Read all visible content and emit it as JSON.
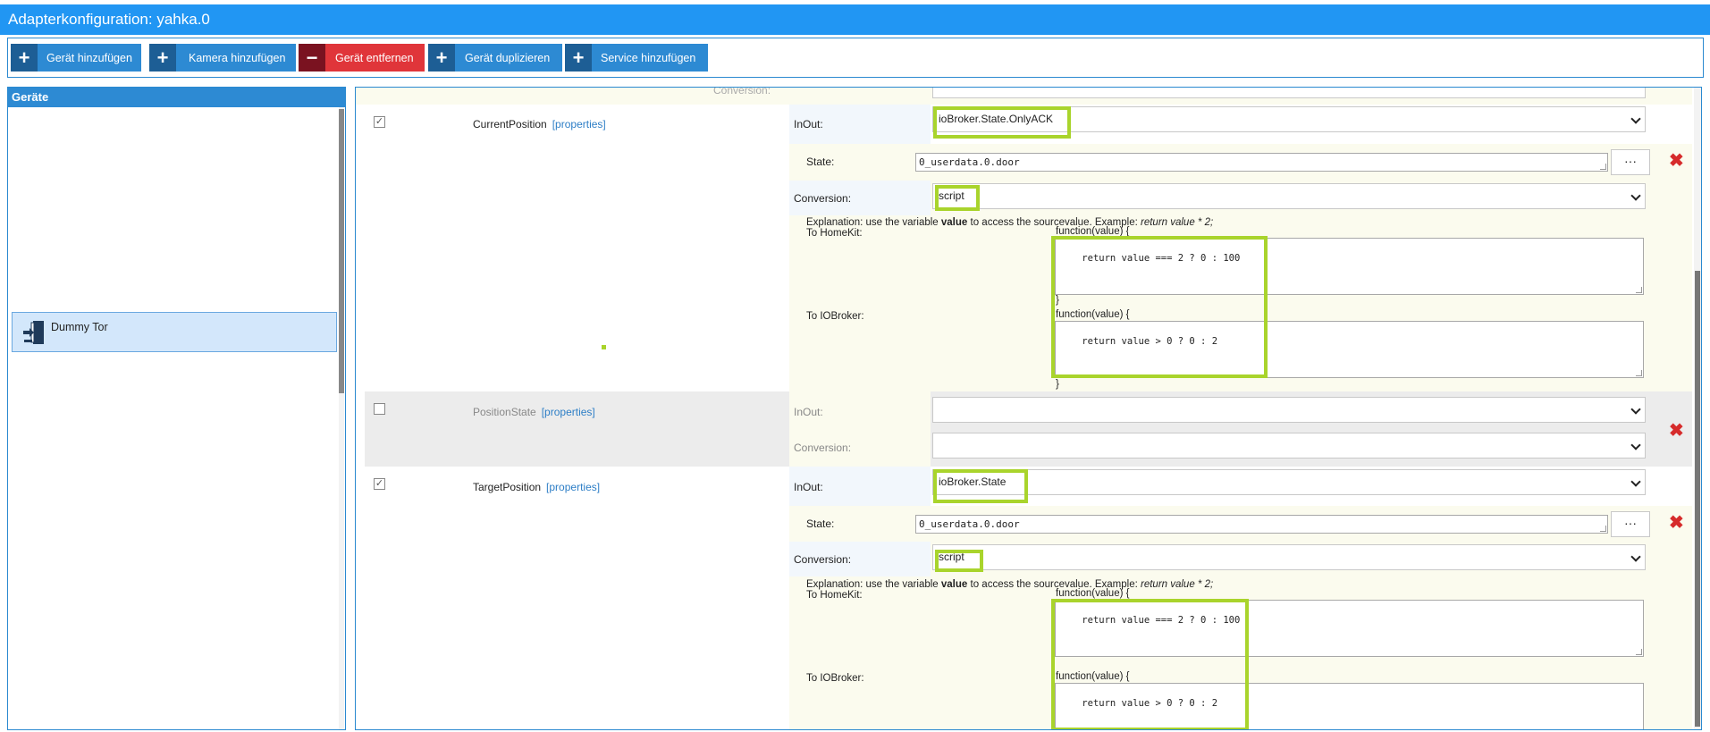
{
  "app": {
    "title": "Adapterkonfiguration: yahka.0"
  },
  "toolbar": {
    "buttons": [
      {
        "icon": "plus-icon",
        "symbol": "+",
        "label": "Gerät hinzufügen"
      },
      {
        "icon": "plus-icon",
        "symbol": "+",
        "label": "Kamera hinzufügen"
      },
      {
        "icon": "minus-icon",
        "symbol": "−",
        "label": "Gerät entfernen"
      },
      {
        "icon": "plus-icon",
        "symbol": "+",
        "label": "Gerät duplizieren"
      },
      {
        "icon": "plus-icon",
        "symbol": "+",
        "label": "Service hinzufügen"
      }
    ]
  },
  "sidebar": {
    "header": "Geräte",
    "items": [
      {
        "icon": "door-exit-icon",
        "label": "Dummy Tor"
      }
    ]
  },
  "main": {
    "clipped_label": "Conversion:",
    "characteristics": [
      {
        "name": "CurrentPosition",
        "properties": "[properties]",
        "checked_glyph": "✓",
        "inout_label": "InOut:",
        "inout_value": "ioBroker.State.OnlyACK",
        "state_label": "State:",
        "state_value": "0_userdata.0.door",
        "dots": "···",
        "conversion_label": "Conversion:",
        "conversion_value": "script",
        "explanation_prefix": "Explanation: use the variable ",
        "explanation_bold": "value",
        "explanation_mid": " to access the sourcevalue. Example: ",
        "explanation_italic": "return value * 2;",
        "to_homekit_label": "To HomeKit:",
        "to_homekit_head": "function(value) {",
        "to_homekit_code": "return value === 2 ? 0 : 100",
        "to_homekit_close": "}",
        "to_iobroker_label": "To IOBroker:",
        "to_iobroker_head": "function(value) {",
        "to_iobroker_code": "return value > 0 ? 0 : 2",
        "to_iobroker_close": "}",
        "delete": "✖"
      },
      {
        "name": "PositionState",
        "properties": "[properties]",
        "inout_label": "InOut:",
        "inout_value": "",
        "conversion_label": "Conversion:",
        "conversion_value": "",
        "delete": "✖"
      },
      {
        "name": "TargetPosition",
        "properties": "[properties]",
        "checked_glyph": "✓",
        "inout_label": "InOut:",
        "inout_value": "ioBroker.State",
        "state_label": "State:",
        "state_value": "0_userdata.0.door",
        "dots": "···",
        "conversion_label": "Conversion:",
        "conversion_value": "script",
        "explanation_prefix": "Explanation: use the variable ",
        "explanation_bold": "value",
        "explanation_mid": " to access the sourcevalue. Example: ",
        "explanation_italic": "return value * 2;",
        "to_homekit_label": "To HomeKit:",
        "to_homekit_head": "function(value) {",
        "to_homekit_code": "return value === 2 ? 0 : 100",
        "to_iobroker_label": "To IOBroker:",
        "to_iobroker_head": "function(value) {",
        "to_iobroker_code": "return value > 0 ? 0 : 2",
        "delete": "✖"
      }
    ]
  },
  "colors": {
    "titlebar": "#2196f3",
    "button_blue": "#2d8ad3",
    "button_red": "#e0353a",
    "highlight": "#a9d42c",
    "delete": "#d62b2b"
  }
}
